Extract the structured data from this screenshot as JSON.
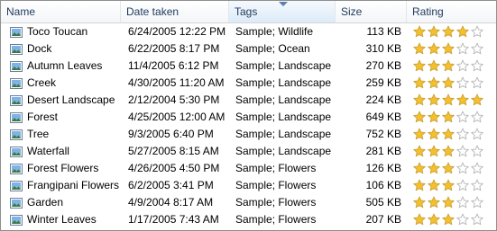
{
  "columns": {
    "name": "Name",
    "date": "Date taken",
    "tags": "Tags",
    "size": "Size",
    "rating": "Rating"
  },
  "icons": {
    "sort": "sort-ascending-icon",
    "file": "image-file-icon",
    "star": "rating-star-icon"
  },
  "colors": {
    "star_filled": "#f6c02a",
    "star_outline": "#c9a13a",
    "star_empty": "#ffffff"
  },
  "files": [
    {
      "name": "Toco Toucan",
      "date": "6/24/2005 12:22 PM",
      "tags": "Sample; Wildlife",
      "size": "113 KB",
      "rating": 4
    },
    {
      "name": "Dock",
      "date": "6/22/2005 8:17 PM",
      "tags": "Sample; Ocean",
      "size": "310 KB",
      "rating": 3
    },
    {
      "name": "Autumn Leaves",
      "date": "11/4/2005 6:12 PM",
      "tags": "Sample; Landscape",
      "size": "270 KB",
      "rating": 3
    },
    {
      "name": "Creek",
      "date": "4/30/2005 11:20 AM",
      "tags": "Sample; Landscape",
      "size": "259 KB",
      "rating": 3
    },
    {
      "name": "Desert Landscape",
      "date": "2/12/2004 5:30 PM",
      "tags": "Sample; Landscape",
      "size": "224 KB",
      "rating": 5
    },
    {
      "name": "Forest",
      "date": "4/25/2005 12:00 AM",
      "tags": "Sample; Landscape",
      "size": "649 KB",
      "rating": 3
    },
    {
      "name": "Tree",
      "date": "9/3/2005 6:40 PM",
      "tags": "Sample; Landscape",
      "size": "752 KB",
      "rating": 3
    },
    {
      "name": "Waterfall",
      "date": "5/27/2005 8:15 AM",
      "tags": "Sample; Landscape",
      "size": "281 KB",
      "rating": 3
    },
    {
      "name": "Forest Flowers",
      "date": "4/26/2005 4:50 PM",
      "tags": "Sample; Flowers",
      "size": "126 KB",
      "rating": 3
    },
    {
      "name": "Frangipani Flowers",
      "date": "6/2/2005 3:41 PM",
      "tags": "Sample; Flowers",
      "size": "106 KB",
      "rating": 3
    },
    {
      "name": "Garden",
      "date": "4/9/2004 8:17 AM",
      "tags": "Sample; Flowers",
      "size": "505 KB",
      "rating": 3
    },
    {
      "name": "Winter Leaves",
      "date": "1/17/2005 7:43 AM",
      "tags": "Sample; Flowers",
      "size": "207 KB",
      "rating": 3
    }
  ]
}
